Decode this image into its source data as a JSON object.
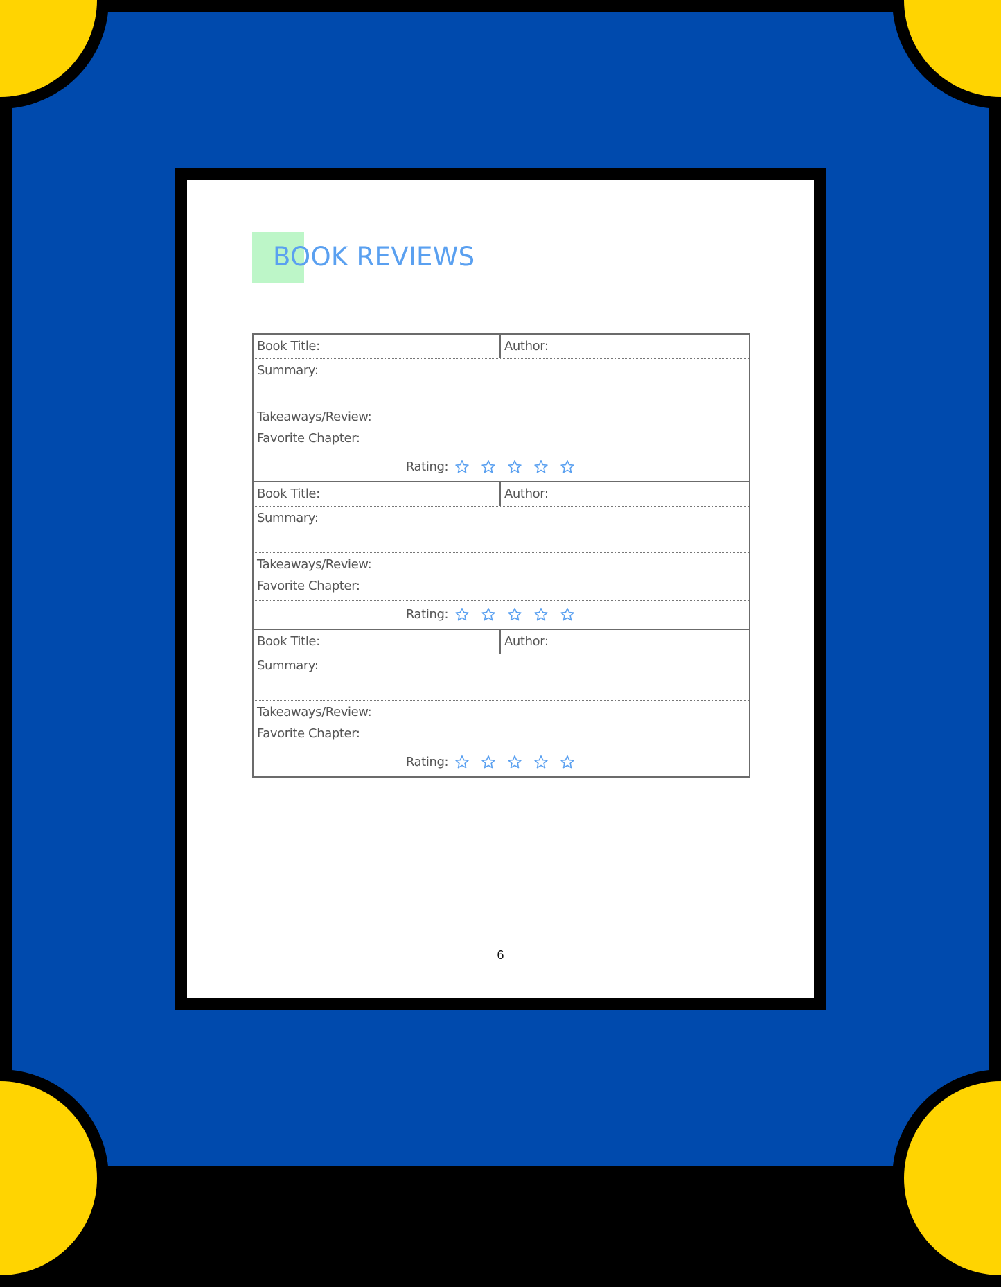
{
  "colors": {
    "background_blue": "#004aad",
    "corner_yellow": "#ffd401",
    "frame_black": "#000000",
    "title_blue": "#5aa0f0",
    "title_accent_green": "#bdf6c8",
    "star_blue": "#5aa0f0",
    "label_gray": "#555555"
  },
  "page": {
    "title": "BOOK REVIEWS",
    "page_number": "6"
  },
  "review_template": {
    "entries": [
      {
        "book_title_label": "Book Title:",
        "author_label": "Author:",
        "summary_label": "Summary:",
        "takeaways_label": "Takeaways/Review:",
        "favorite_chapter_label": "Favorite Chapter:",
        "rating_label": "Rating:",
        "rating_value": 0,
        "rating_max": 5,
        "star_icon": "star-outline-icon"
      },
      {
        "book_title_label": "Book Title:",
        "author_label": "Author:",
        "summary_label": "Summary:",
        "takeaways_label": "Takeaways/Review:",
        "favorite_chapter_label": "Favorite Chapter:",
        "rating_label": "Rating:",
        "rating_value": 0,
        "rating_max": 5,
        "star_icon": "star-outline-icon"
      },
      {
        "book_title_label": "Book Title:",
        "author_label": "Author:",
        "summary_label": "Summary:",
        "takeaways_label": "Takeaways/Review:",
        "favorite_chapter_label": "Favorite Chapter:",
        "rating_label": "Rating:",
        "rating_value": 0,
        "rating_max": 5,
        "star_icon": "star-outline-icon"
      }
    ]
  }
}
